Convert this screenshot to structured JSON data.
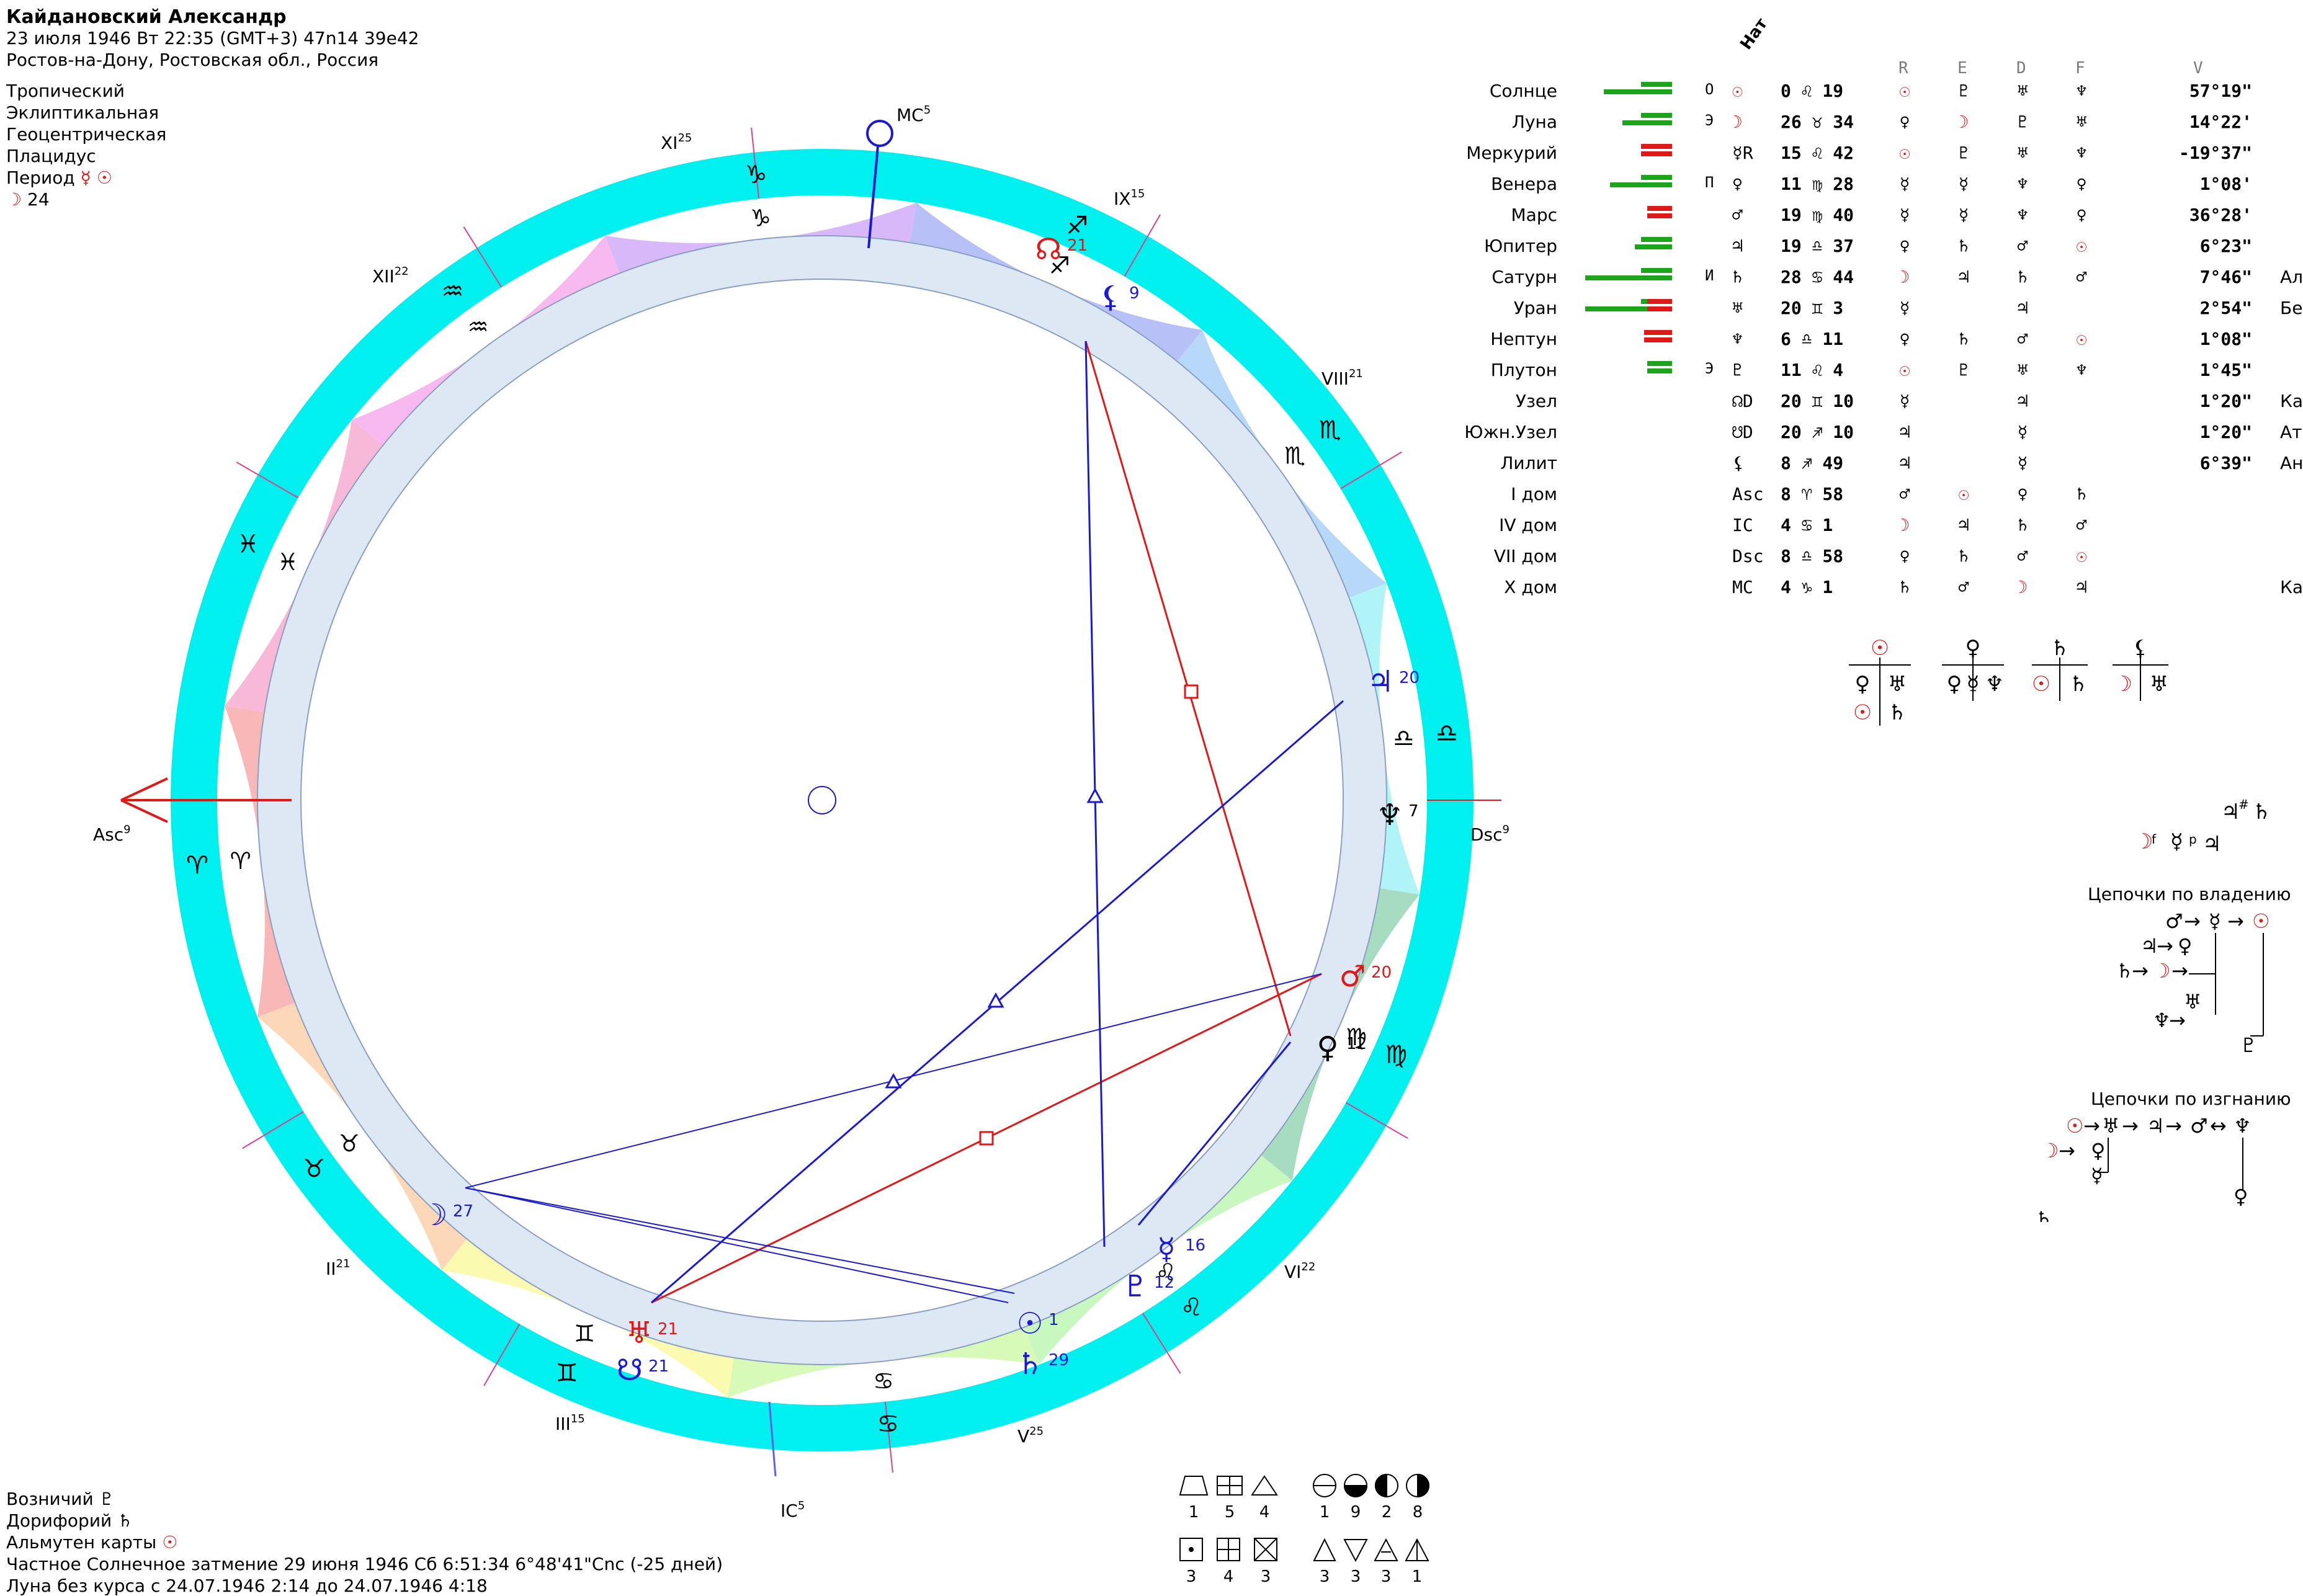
{
  "header": {
    "name": "Кайдановский Александр",
    "date_line": "23 июля 1946  Вт  22:35 (GMT+3) 47n14  39e42",
    "place_line": "Ростов-на-Дону, Ростовская обл., Россия",
    "settings": [
      "Тропический",
      "Эклиптикальная",
      "Геоцентрическая",
      "Плацидус"
    ],
    "period_label": "Период",
    "period_glyphs": "☿ ☉",
    "period_moon": "☽",
    "period_num": "24"
  },
  "wheel": {
    "axes": {
      "asc": "Asc",
      "asc_deg": "9",
      "dsc": "Dsc",
      "dsc_deg": "9",
      "mc": "MC",
      "mc_deg": "5",
      "ic": "IC",
      "ic_deg": "5"
    },
    "houses": [
      {
        "name": "II",
        "deg": "21"
      },
      {
        "name": "III",
        "deg": "15"
      },
      {
        "name": "V",
        "deg": "25"
      },
      {
        "name": "VI",
        "deg": "22"
      },
      {
        "name": "VIII",
        "deg": "21"
      },
      {
        "name": "IX",
        "deg": "15"
      },
      {
        "name": "XI",
        "deg": "25"
      },
      {
        "name": "XII",
        "deg": "22"
      }
    ],
    "signs": [
      "♈",
      "♉",
      "♊",
      "♋",
      "♌",
      "♍",
      "♎",
      "♏",
      "♐",
      "♑",
      "♒",
      "♓"
    ],
    "planets": [
      {
        "glyph": "☉",
        "deg": "1",
        "color": "#1a1ad0"
      },
      {
        "glyph": "♄",
        "deg": "29",
        "color": "#1a1ad0"
      },
      {
        "glyph": "☿",
        "deg": "16",
        "color": "#1a1ad0"
      },
      {
        "glyph": "♀",
        "deg": "12",
        "color": "#000000"
      },
      {
        "glyph": "♂",
        "deg": "20",
        "color": "#e01818"
      },
      {
        "glyph": "♆",
        "deg": "7",
        "color": "#000000"
      },
      {
        "glyph": "♃",
        "deg": "20",
        "color": "#1a1ad0"
      },
      {
        "glyph": "⚸",
        "deg": "9",
        "color": "#1a1ad0"
      },
      {
        "glyph": "☊",
        "deg": "21",
        "color": "#e01818"
      },
      {
        "glyph": "♅",
        "deg": "21",
        "color": "#e01818"
      },
      {
        "glyph": "☋",
        "deg": "21",
        "color": "#1a1ad0"
      },
      {
        "glyph": "☽",
        "deg": "27",
        "color": "#1a1ad0"
      },
      {
        "glyph": "♇",
        "deg": "12",
        "color": "#1a1ad0"
      }
    ]
  },
  "table": {
    "nat_label": "Нат",
    "columns": [
      "R",
      "E",
      "D",
      "F",
      "V"
    ],
    "rows": [
      {
        "name": "Солнце",
        "lvl": "О",
        "sym": "☉",
        "pos": "0 ♌ 19",
        "r": "☉",
        "e": "♇",
        "d": "♅",
        "f": "♆",
        "v": "57°19\"",
        "star": ""
      },
      {
        "name": "Луна",
        "lvl": "Э",
        "sym": "☽",
        "pos": "26 ♉ 34",
        "r": "♀",
        "e": "☽",
        "d": "♇",
        "f": "♅",
        "v": "14°22'",
        "star": ""
      },
      {
        "name": "Меркурий",
        "lvl": "",
        "sym": "☿R",
        "pos": "15 ♌ 42",
        "r": "☉",
        "e": "♇",
        "d": "♅",
        "f": "♆",
        "v": "-19°37\"",
        "star": ""
      },
      {
        "name": "Венера",
        "lvl": "П",
        "sym": "♀",
        "pos": "11 ♍ 28",
        "r": "☿",
        "e": "☿",
        "d": "♆",
        "f": "♀",
        "v": "1°08'",
        "star": ""
      },
      {
        "name": "Марс",
        "lvl": "",
        "sym": "♂",
        "pos": "19 ♍ 40",
        "r": "☿",
        "e": "☿",
        "d": "♆",
        "f": "♀",
        "v": "36°28'",
        "star": ""
      },
      {
        "name": "Юпитер",
        "lvl": "",
        "sym": "♃",
        "pos": "19 ♎ 37",
        "r": "♀",
        "e": "♄",
        "d": "♂",
        "f": "☉",
        "v": "6°23\"",
        "star": ""
      },
      {
        "name": "Сатурн",
        "lvl": "И",
        "sym": "♄",
        "pos": "28 ♋ 44",
        "r": "☽",
        "e": "♃",
        "d": "♄",
        "f": "♂",
        "v": "7°46\"",
        "star": "Алюдра"
      },
      {
        "name": "Уран",
        "lvl": "",
        "sym": "♅",
        "pos": "20 ♊ 3",
        "r": "☿",
        "e": "",
        "d": "♃",
        "f": "",
        "v": "2°54\"",
        "star": "Беллатрикс"
      },
      {
        "name": "Нептун",
        "lvl": "",
        "sym": "♆",
        "pos": "6 ♎ 11",
        "r": "♀",
        "e": "♄",
        "d": "♂",
        "f": "☉",
        "v": "1°08\"",
        "star": ""
      },
      {
        "name": "Плутон",
        "lvl": "Э",
        "sym": "♇",
        "pos": "11 ♌ 4",
        "r": "☉",
        "e": "♇",
        "d": "♅",
        "f": "♆",
        "v": "1°45\"",
        "star": ""
      },
      {
        "name": "Узел",
        "lvl": "",
        "sym": "☊D",
        "pos": "20 ♊ 10",
        "r": "☿",
        "e": "",
        "d": "♃",
        "f": "",
        "v": "1°20\"",
        "star": "Капелла"
      },
      {
        "name": "Южн.Узел",
        "lvl": "",
        "sym": "☋D",
        "pos": "20 ♐ 10",
        "r": "♃",
        "e": "",
        "d": "☿",
        "f": "",
        "v": "1°20\"",
        "star": "Атрия"
      },
      {
        "name": "Лилит",
        "lvl": "",
        "sym": "⚸",
        "pos": "8 ♐ 49",
        "r": "♃",
        "e": "",
        "d": "☿",
        "f": "",
        "v": "6°39\"",
        "star": "Антарес"
      },
      {
        "name": "I дом",
        "lvl": "",
        "sym": "Asc",
        "pos": "8 ♈ 58",
        "r": "♂",
        "e": "☉",
        "d": "♀",
        "f": "♄",
        "v": "",
        "star": ""
      },
      {
        "name": "IV дом",
        "lvl": "",
        "sym": "IC",
        "pos": "4 ♋ 1",
        "r": "☽",
        "e": "♃",
        "d": "♄",
        "f": "♂",
        "v": "",
        "star": ""
      },
      {
        "name": "VII дом",
        "lvl": "",
        "sym": "Dsc",
        "pos": "8 ♎ 58",
        "r": "♀",
        "e": "♄",
        "d": "♂",
        "f": "☉",
        "v": "",
        "star": ""
      },
      {
        "name": "X дом",
        "lvl": "",
        "sym": "MC",
        "pos": "4 ♑ 1",
        "r": "♄",
        "e": "♂",
        "d": "☽",
        "f": "♃",
        "v": "",
        "star": "Каус Медиус"
      }
    ]
  },
  "chains": {
    "ownership_title": "Цепочки по владению",
    "exile_title": "Цепочки по изгнанию"
  },
  "footer": {
    "charioteer_label": "Возничий",
    "charioteer_glyph": "♇",
    "doryphory_label": "Дорифорий",
    "doryphory_glyph": "♄",
    "almuten_label": "Альмутен карты",
    "almuten_glyph": "☉",
    "eclipse_line": "Частное Солнечное затмение 29 июня 1946 Сб  6:51:34  6°48'41\"Cnc (-25 дней)",
    "moon_void_line": "Луна без курса с 24.07.1946  2:14 до 24.07.1946  4:18"
  },
  "legend": {
    "shapes_counts": [
      "1",
      "5",
      "4",
      "3",
      "4",
      "3"
    ],
    "phase_counts": [
      "1",
      "9",
      "2",
      "8"
    ],
    "triangle_counts": [
      "3",
      "3",
      "3",
      "1"
    ]
  },
  "colors": {
    "outer_ring": "#00f0f0",
    "aspect_blue": "#1a1ad0",
    "aspect_red": "#e01818",
    "bar_green": "#1ba51b",
    "bar_red": "#e01818"
  }
}
